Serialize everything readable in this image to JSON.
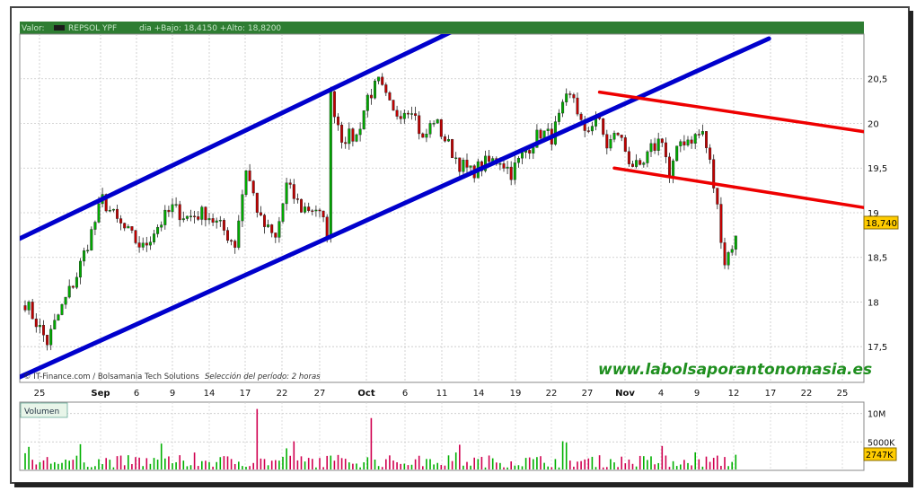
{
  "header": {
    "prefix": "Valor:",
    "symbol": "REPSOL YPF",
    "detail": "dia +Bajo: 18,4150 +Alto: 18,8200"
  },
  "credits": {
    "source": "© IT-Finance.com / Bolsamania Tech Solutions",
    "period": "Selección del período: 2 horas"
  },
  "watermark": "www.labolsaporantonomasia.es",
  "volume_label": "Volumen",
  "price_badge": "18,740",
  "colors": {
    "candle_up": "#00aa00",
    "candle_down": "#c00000",
    "channel": "#0000cc",
    "resistance": "#ee0000",
    "volume_up": "#00b000",
    "volume_down": "#d00050",
    "badge": "#ffcc00",
    "header_bg": "#2e7d32"
  },
  "chart_data": [
    {
      "type": "candlestick",
      "ylim": [
        17.1,
        21
      ],
      "yticks": [
        "20,5",
        "20",
        "19,5",
        "19",
        "18,5",
        "18",
        "17,5"
      ],
      "ytick_values": [
        20.5,
        20,
        19.5,
        19,
        18.5,
        18,
        17.5
      ],
      "xtick_labels": [
        "25",
        "Sep",
        "6",
        "9",
        "14",
        "17",
        "22",
        "27",
        "Oct",
        "6",
        "11",
        "14",
        "19",
        "22",
        "27",
        "Nov",
        "4",
        "9",
        "12",
        "17",
        "22",
        "25"
      ],
      "bold_xticks": [
        "Sep",
        "Oct",
        "Nov"
      ],
      "close_path": [
        [
          0,
          18.0
        ],
        [
          6,
          17.55
        ],
        [
          9,
          17.85
        ],
        [
          14,
          18.3
        ],
        [
          19,
          18.9
        ],
        [
          21,
          19.15
        ],
        [
          25,
          18.9
        ],
        [
          32,
          18.6
        ],
        [
          35,
          18.8
        ],
        [
          40,
          19.05
        ],
        [
          44,
          18.95
        ],
        [
          49,
          19.0
        ],
        [
          54,
          18.8
        ],
        [
          57,
          18.65
        ],
        [
          60,
          19.5
        ],
        [
          64,
          18.9
        ],
        [
          68,
          18.7
        ],
        [
          71,
          19.3
        ],
        [
          75,
          19.05
        ],
        [
          79,
          19.05
        ],
        [
          82,
          18.8
        ],
        [
          83,
          20.3
        ],
        [
          86,
          19.85
        ],
        [
          90,
          19.85
        ],
        [
          93,
          20.3
        ],
        [
          96,
          20.45
        ],
        [
          100,
          20.1
        ],
        [
          105,
          20.2
        ],
        [
          108,
          19.8
        ],
        [
          111,
          20.05
        ],
        [
          115,
          19.75
        ],
        [
          118,
          19.55
        ],
        [
          121,
          19.45
        ],
        [
          125,
          19.55
        ],
        [
          129,
          19.6
        ],
        [
          132,
          19.45
        ],
        [
          136,
          19.7
        ],
        [
          140,
          19.9
        ],
        [
          143,
          19.85
        ],
        [
          147,
          20.25
        ],
        [
          149,
          20.3
        ],
        [
          152,
          19.85
        ],
        [
          155,
          20.1
        ],
        [
          158,
          19.75
        ],
        [
          161,
          19.9
        ],
        [
          164,
          19.6
        ],
        [
          167,
          19.45
        ],
        [
          170,
          19.7
        ],
        [
          173,
          19.85
        ],
        [
          175,
          19.4
        ],
        [
          178,
          19.8
        ],
        [
          182,
          19.85
        ],
        [
          184,
          19.9
        ],
        [
          186,
          19.55
        ],
        [
          188,
          19.05
        ],
        [
          190,
          18.45
        ],
        [
          193,
          18.74
        ]
      ],
      "trendlines": [
        {
          "color": "channel",
          "points": [
            [
              -2,
              18.7
            ],
            [
              117,
              21.05
            ]
          ]
        },
        {
          "color": "channel",
          "points": [
            [
              -2,
              17.15
            ],
            [
              202,
              20.95
            ]
          ]
        },
        {
          "color": "resistance",
          "points": [
            [
              156,
              20.35
            ],
            [
              229,
              19.9
            ]
          ]
        },
        {
          "color": "resistance",
          "points": [
            [
              160,
              19.5
            ],
            [
              229,
              19.05
            ]
          ]
        }
      ],
      "last_price": 18.74
    },
    {
      "type": "bar",
      "title": "Volumen",
      "ylim": [
        0,
        12000
      ],
      "yticks": [
        "10M",
        "5000K"
      ],
      "ytick_values": [
        10000,
        5000
      ],
      "last_value_label": "2747K",
      "last_value": 2747,
      "unit": "K"
    }
  ]
}
